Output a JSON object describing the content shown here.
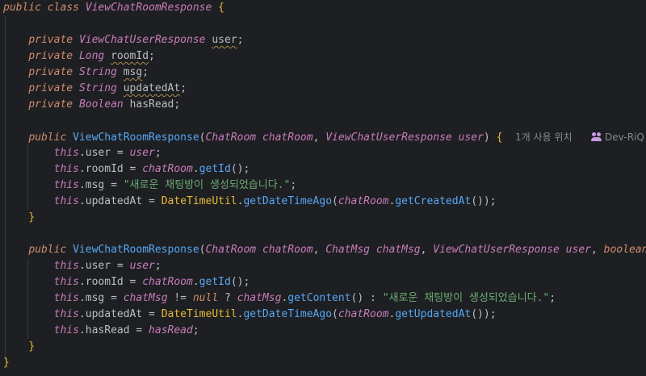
{
  "lines": [
    {
      "t": "public class ViewChatRoomResponse {"
    },
    {
      "t": ""
    },
    {
      "t": "private ViewChatUserResponse user;"
    },
    {
      "t": "private Long roomId;"
    },
    {
      "t": "private String msg;"
    },
    {
      "t": "private String updatedAt;"
    },
    {
      "t": "private Boolean hasRead;"
    },
    {
      "t": ""
    },
    {
      "t": "public ViewChatRoomResponse(ChatRoom chatRoom, ViewChatUserResponse user) {"
    },
    {
      "t": "this.user = user;"
    },
    {
      "t": "this.roomId = chatRoom.getId();"
    },
    {
      "t": "this.msg = \"새로운 채팅방이 생성되었습니다.\";"
    },
    {
      "t": "this.updatedAt = DateTimeUtil.getDateTimeAgo(chatRoom.getCreatedAt());"
    },
    {
      "t": "}"
    },
    {
      "t": ""
    },
    {
      "t": "public ViewChatRoomResponse(ChatRoom chatRoom, ChatMsg chatMsg, ViewChatUserResponse user, boolean hasRead) {"
    },
    {
      "t": "this.user = user;"
    },
    {
      "t": "this.roomId = chatRoom.getId();"
    },
    {
      "t": "this.msg = chatMsg != null ? chatMsg.getContent() : \"새로운 채팅방이 생성되었습니다.\";"
    },
    {
      "t": "this.updatedAt = DateTimeUtil.getDateTimeAgo(chatRoom.getUpdatedAt());"
    },
    {
      "t": "this.hasRead = hasRead;"
    },
    {
      "t": "}"
    },
    {
      "t": "}"
    }
  ],
  "tokens": {
    "public": "public",
    "class": "class",
    "private": "private",
    "boolean": "boolean",
    "this": "this",
    "null": "null",
    "class_name": "ViewChatRoomResponse",
    "type_user_resp": "ViewChatUserResponse",
    "type_long": "Long",
    "type_string": "String",
    "type_boolean": "Boolean",
    "type_chatroom": "ChatRoom",
    "type_chatmsg": "ChatMsg",
    "util_class": "DateTimeUtil",
    "field_user": "user",
    "field_roomId": "roomId",
    "field_msg": "msg",
    "field_updatedAt": "updatedAt",
    "field_hasRead": "hasRead",
    "param_chatRoom": "chatRoom",
    "param_user": "user",
    "param_chatMsg": "chatMsg",
    "param_hasRead": "hasRead",
    "method_getId": "getId",
    "method_getDateTimeAgo": "getDateTimeAgo",
    "method_getCreatedAt": "getCreatedAt",
    "method_getUpdatedAt": "getUpdatedAt",
    "method_getContent": "getContent",
    "string_created": "\"새로운 채팅방이 생성되었습니다.\""
  },
  "inlay_hint": {
    "usages": "1개 사용 위치",
    "author": "Dev-RiQ",
    "author_icon": "users-icon"
  },
  "colors": {
    "background": "#1e1f22",
    "keyword": "#cf8e6d",
    "type": "#c77dbb",
    "method": "#56a8f5",
    "string": "#6aab73",
    "brace": "#e8ba36",
    "text": "#bcbec4",
    "hint": "#868a91"
  }
}
